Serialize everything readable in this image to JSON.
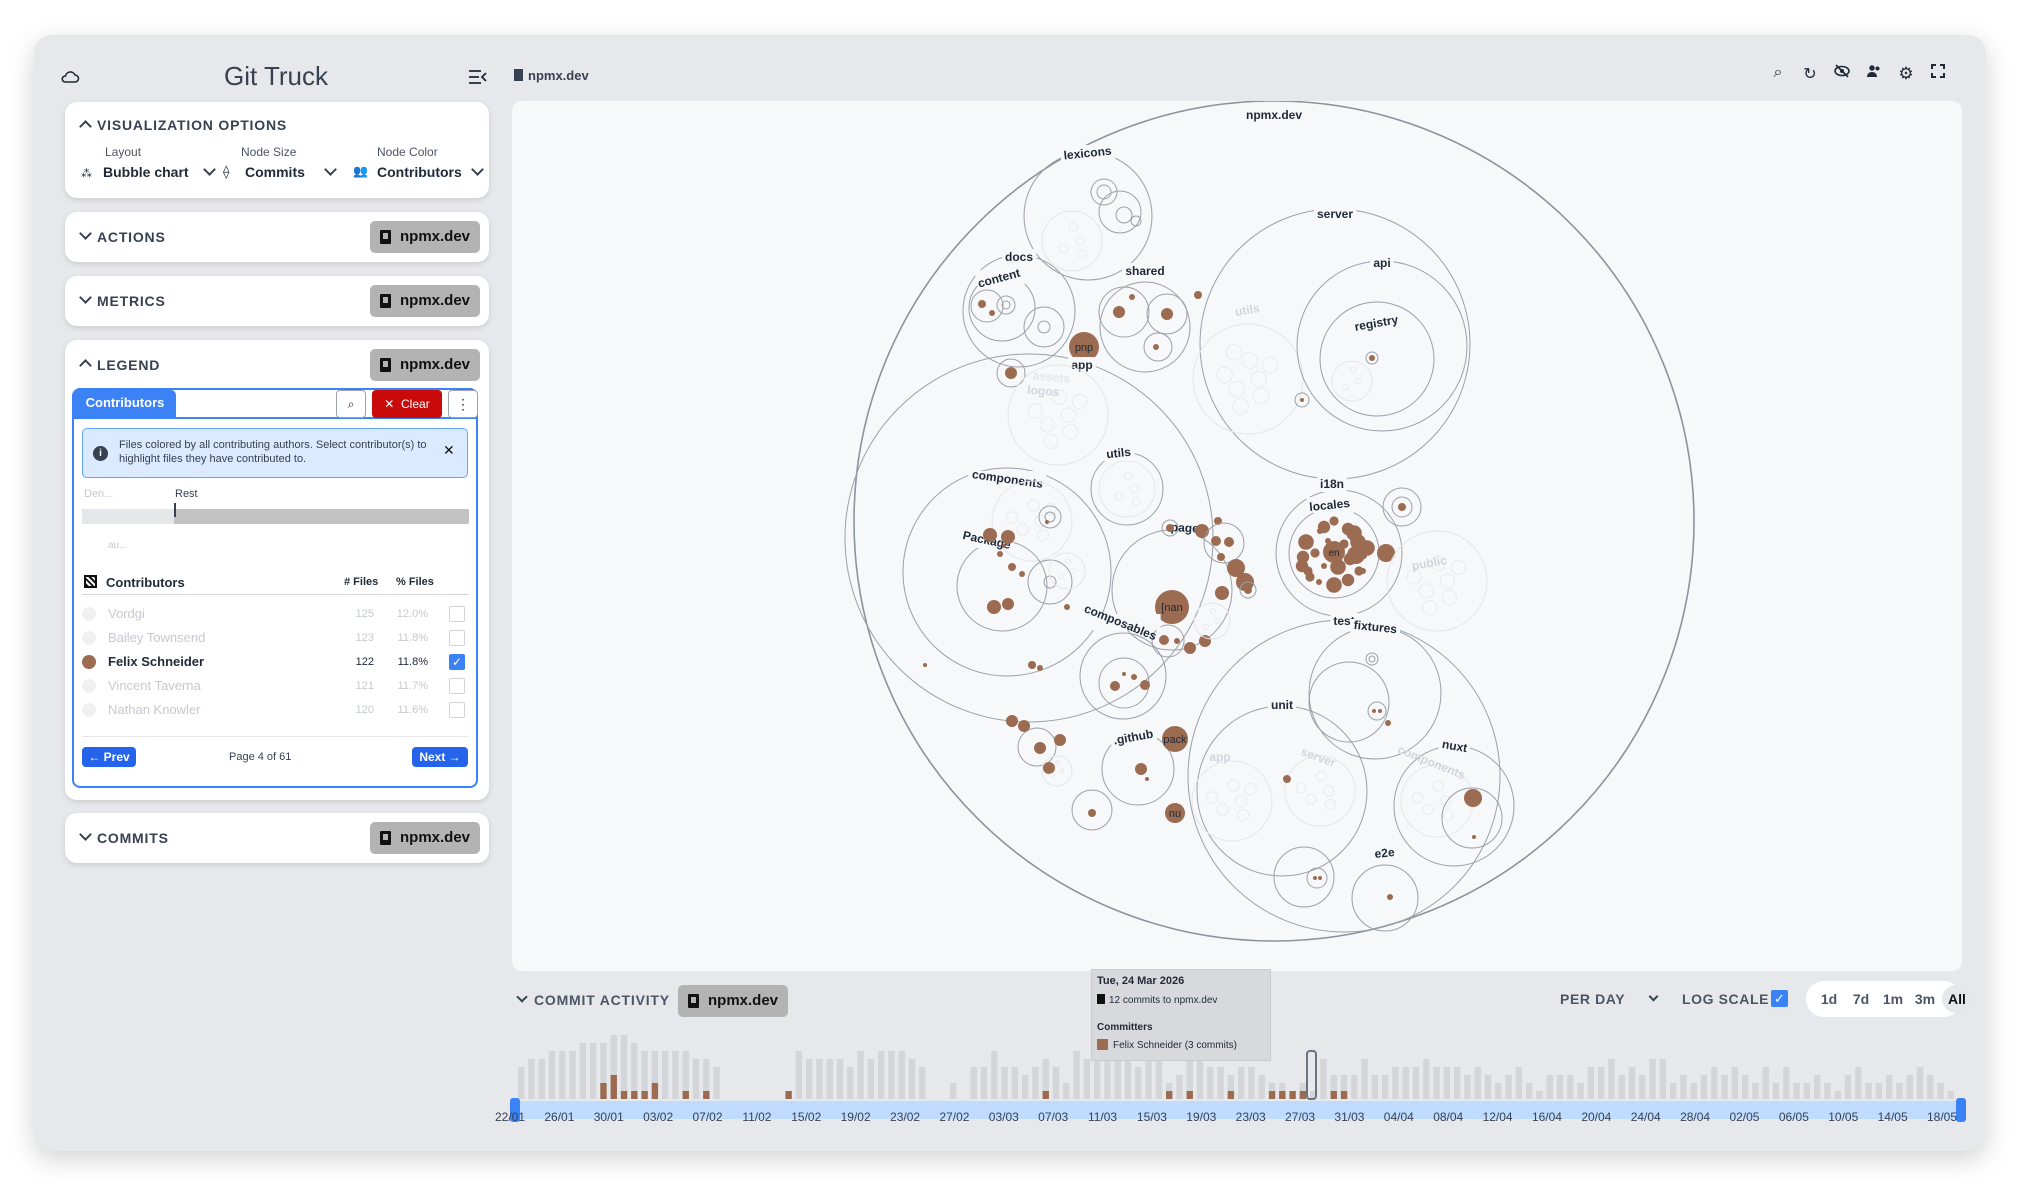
{
  "app": {
    "title": "Git Truck",
    "repo": "npmx.dev"
  },
  "visualization_options": {
    "header": "VISUALIZATION OPTIONS",
    "layout_label": "Layout",
    "layout_value": "Bubble chart",
    "size_label": "Node Size",
    "size_value": "Commits",
    "color_label": "Node Color",
    "color_value": "Contributors"
  },
  "actions": {
    "header": "ACTIONS",
    "chip": "npmx.dev"
  },
  "metrics": {
    "header": "METRICS",
    "chip": "npmx.dev"
  },
  "legend": {
    "header": "LEGEND",
    "chip": "npmx.dev",
    "tab": "Contributors",
    "clear": "Clear",
    "info": "Files colored by all contributing authors. Select contributor(s) to highlight files they have contributed to.",
    "bar_label_left": "Den...",
    "bar_label_rest": "Rest",
    "bar_label_below": "au...",
    "table_header": "Contributors",
    "col_files": "# Files",
    "col_pct": "% Files",
    "rows": [
      {
        "name": "Vordgi",
        "files": "125",
        "pct": "12.0%",
        "checked": false,
        "faded": true
      },
      {
        "name": "Bailey Townsend",
        "files": "123",
        "pct": "11.8%",
        "checked": false,
        "faded": true
      },
      {
        "name": "Felix Schneider",
        "files": "122",
        "pct": "11.8%",
        "checked": true,
        "faded": false
      },
      {
        "name": "Vincent Taverna",
        "files": "121",
        "pct": "11.7%",
        "checked": false,
        "faded": true
      },
      {
        "name": "Nathan Knowler",
        "files": "120",
        "pct": "11.6%",
        "checked": false,
        "faded": true
      }
    ],
    "prev": "← Prev",
    "page": "Page 4 of 61",
    "next": "Next →",
    "highlight_color": "#9b6b52"
  },
  "commits": {
    "header": "COMMITS",
    "chip": "npmx.dev"
  },
  "bubble_labels": {
    "root": "npmx.dev",
    "lexicons": "lexicons",
    "server": "server",
    "api": "api",
    "registry": "registry",
    "utils_ghost": "utils",
    "docs": "docs",
    "content": "content",
    "shared": "shared",
    "pnp": "pnp",
    "app": "app",
    "assets": "assets",
    "logos": "logos",
    "utils": "utils",
    "components": "components",
    "pages": "pages",
    "package": "Package",
    "name": "[nan",
    "i18n": "i18n",
    "locales": "locales",
    "en": "en",
    "public": "public",
    "composables": "composables",
    "github": ".github",
    "pack": "pack",
    "nu": "nu",
    "test": "test",
    "fixtures": "fixtures",
    "unit": "unit",
    "app_ghost": "app",
    "server_ghost": "server",
    "nuxt": "nuxt",
    "components_ghost": "components",
    "e2e": "e2e"
  },
  "commit_activity": {
    "header": "COMMIT ACTIVITY",
    "chip": "npmx.dev",
    "per": "PER DAY",
    "log_scale": "LOG SCALE",
    "log_checked": true,
    "ranges": [
      "1d",
      "7d",
      "1m",
      "3m",
      "All"
    ],
    "active_range": "All",
    "tooltip": {
      "date": "Tue, 24 Mar 2026",
      "commits": "12 commits to npmx.dev",
      "committers_label": "Committers",
      "committer": "Felix Schneider (3 commits)"
    },
    "ticks": [
      "22/01",
      "26/01",
      "30/01",
      "03/02",
      "07/02",
      "11/02",
      "15/02",
      "19/02",
      "23/02",
      "27/02",
      "03/03",
      "07/03",
      "11/03",
      "15/03",
      "19/03",
      "23/03",
      "27/03",
      "31/03",
      "04/04",
      "08/04",
      "12/04",
      "16/04",
      "20/04",
      "24/04",
      "28/04",
      "02/05",
      "06/05",
      "10/05",
      "14/05",
      "18/05"
    ]
  },
  "chart_data": {
    "type": "bar",
    "title": "COMMIT ACTIVITY",
    "xlabel": "",
    "ylabel": "",
    "log_scale": true,
    "x_start": "22/01",
    "x_end": "18/05",
    "series": [
      {
        "name": "total",
        "values": [
          4,
          5,
          5,
          6,
          6,
          6,
          7,
          7,
          7,
          8,
          8,
          7,
          6,
          6,
          6,
          6,
          6,
          5,
          5,
          4,
          0,
          0,
          0,
          0,
          0,
          0,
          0,
          6,
          5,
          5,
          5,
          5,
          4,
          6,
          5,
          6,
          6,
          6,
          5,
          4,
          0,
          0,
          2,
          0,
          4,
          4,
          6,
          4,
          4,
          3,
          4,
          5,
          4,
          2,
          6,
          5,
          5,
          5,
          5,
          5,
          4,
          5,
          7,
          2,
          3,
          5,
          5,
          4,
          4,
          3,
          4,
          4,
          3,
          2,
          2,
          1,
          2,
          1,
          5,
          3,
          3,
          3,
          5,
          3,
          3,
          4,
          4,
          4,
          5,
          4,
          4,
          4,
          3,
          4,
          3,
          2,
          3,
          4,
          2,
          1,
          3,
          3,
          3,
          2,
          4,
          4,
          5,
          3,
          4,
          3,
          5,
          5,
          2,
          3,
          2,
          3,
          4,
          3,
          4,
          3,
          2,
          4,
          2,
          4,
          2,
          2,
          3,
          2,
          1,
          3,
          4,
          2,
          2,
          3,
          2,
          3,
          4,
          3,
          2,
          1
        ]
      },
      {
        "name": "Felix Schneider",
        "values": [
          0,
          0,
          0,
          0,
          0,
          0,
          0,
          0,
          2,
          3,
          1,
          1,
          1,
          2,
          0,
          0,
          1,
          0,
          1,
          0,
          0,
          0,
          0,
          0,
          0,
          0,
          1,
          0,
          0,
          0,
          0,
          0,
          0,
          0,
          0,
          0,
          0,
          0,
          0,
          0,
          0,
          0,
          0,
          0,
          0,
          0,
          0,
          0,
          0,
          0,
          0,
          1,
          0,
          0,
          0,
          0,
          0,
          0,
          0,
          0,
          0,
          0,
          0,
          1,
          0,
          1,
          0,
          0,
          0,
          1,
          0,
          0,
          0,
          1,
          1,
          1,
          1,
          0,
          0,
          1,
          1,
          0,
          0,
          0,
          0,
          0,
          0,
          0,
          0,
          0,
          0,
          0,
          0,
          0,
          0,
          0,
          0,
          0,
          0,
          0,
          0,
          0,
          0,
          0,
          0,
          0,
          0,
          0,
          0,
          0,
          0,
          0,
          0,
          0,
          0,
          0,
          0,
          0,
          0,
          0,
          0,
          0,
          0,
          0,
          0,
          0,
          0,
          0,
          0,
          0,
          0,
          0,
          0,
          0,
          0,
          0,
          0,
          0
        ]
      }
    ]
  }
}
